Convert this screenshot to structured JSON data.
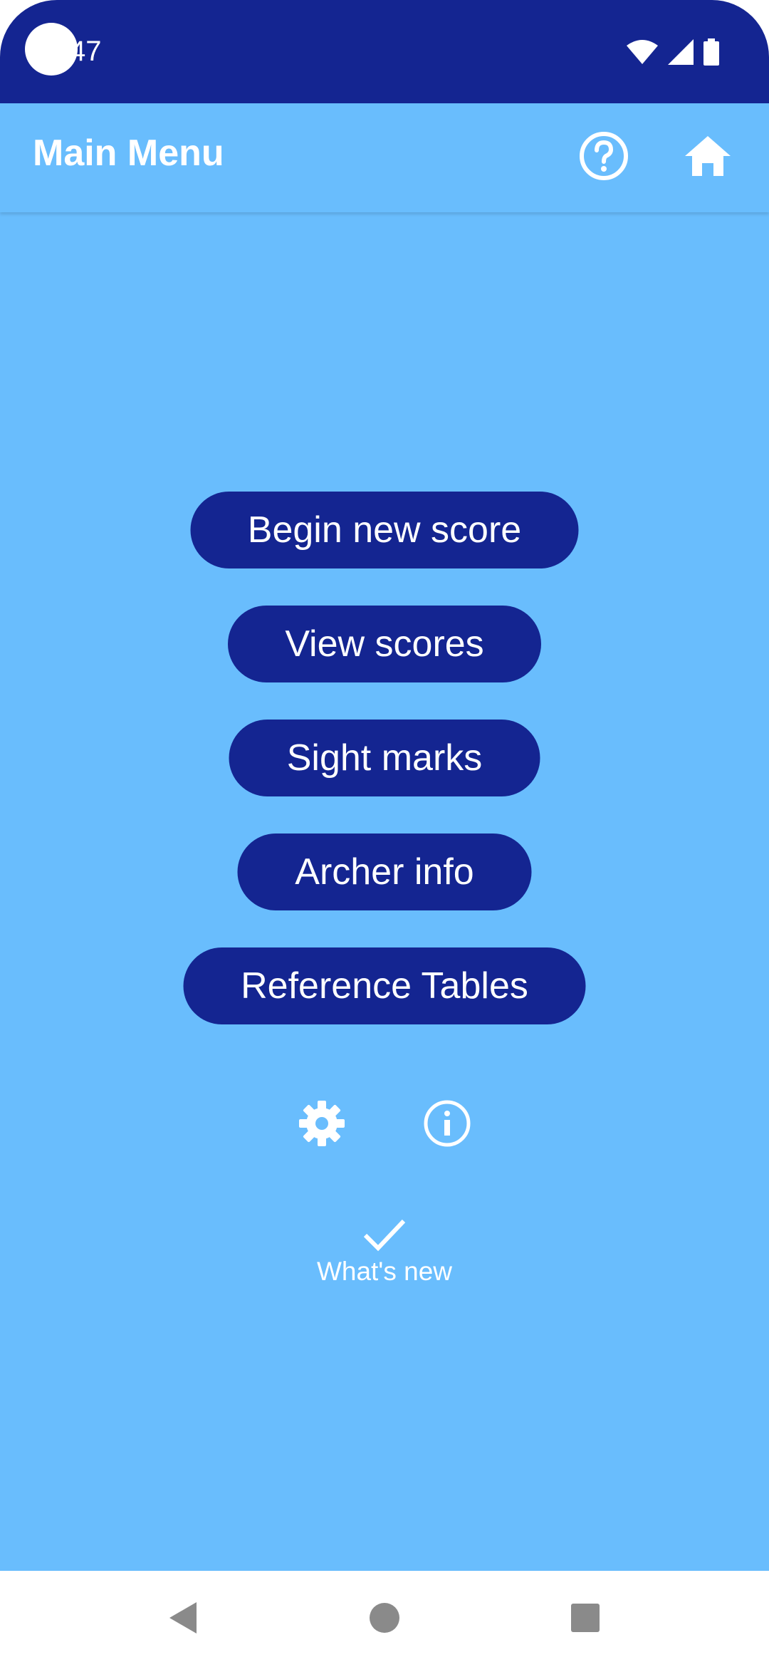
{
  "status_bar": {
    "time": "47",
    "icons": [
      "wifi-icon",
      "signal-icon",
      "battery-icon"
    ]
  },
  "app_bar": {
    "title": "Main Menu",
    "actions": [
      "help-icon",
      "home-icon"
    ]
  },
  "menu": {
    "begin_new_score": "Begin new score",
    "view_scores": "View scores",
    "sight_marks": "Sight marks",
    "archer_info": "Archer info",
    "reference_tables": "Reference Tables"
  },
  "bottom_actions": {
    "icons": [
      "settings-gear-icon",
      "info-icon"
    ],
    "whats_new_label": "What's new",
    "whats_new_icon": "checkmark-icon"
  },
  "nav_bar": {
    "icons": [
      "back-icon",
      "home-circle-icon",
      "recents-icon"
    ]
  },
  "colors": {
    "primary_dark": "#142591",
    "background": "#69bdfd",
    "text_light": "#ffffff",
    "nav_icon": "#8a8a8a"
  }
}
